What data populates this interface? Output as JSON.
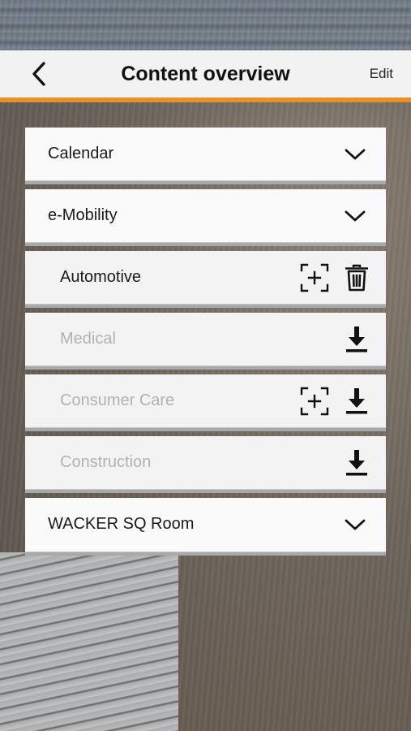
{
  "nav": {
    "title": "Content overview",
    "back_icon": "chevron-left-icon",
    "edit_label": "Edit",
    "accent_color": "#e8912c"
  },
  "content": {
    "items": [
      {
        "label": "Calendar",
        "type": "category",
        "state": "collapsed",
        "actions": [
          "chevron-down-icon"
        ]
      },
      {
        "label": "e-Mobility",
        "type": "category",
        "state": "collapsed",
        "actions": [
          "chevron-down-icon"
        ]
      },
      {
        "label": "Automotive",
        "type": "content",
        "state": "downloaded",
        "actions": [
          "ar-scan-icon",
          "trash-icon"
        ]
      },
      {
        "label": "Medical",
        "type": "content",
        "state": "not-downloaded",
        "actions": [
          "download-icon"
        ]
      },
      {
        "label": "Consumer Care",
        "type": "content",
        "state": "not-downloaded",
        "actions": [
          "ar-scan-icon",
          "download-icon"
        ]
      },
      {
        "label": "Construction",
        "type": "content",
        "state": "not-downloaded",
        "actions": [
          "download-icon"
        ]
      },
      {
        "label": "WACKER SQ Room",
        "type": "category",
        "state": "collapsed",
        "actions": [
          "chevron-down-icon"
        ]
      }
    ]
  }
}
